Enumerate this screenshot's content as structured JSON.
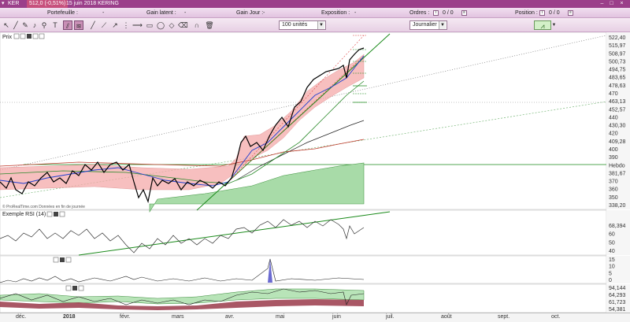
{
  "titlebar": {
    "ticker": "KER",
    "price_change": "512,0 (-0,51%)",
    "date_name": "15 juin 2018 KERING"
  },
  "summary": {
    "portefeuille_label": "Portefeuille :",
    "portefeuille_value": "-",
    "gain_latent_label": "Gain latent :",
    "gain_latent_value": "-",
    "gain_jour_label": "Gain Jour :",
    "gain_jour_value": "-",
    "exposition_label": "Exposition :",
    "exposition_value": "-",
    "ordres_label": "Ordres :",
    "ordres_value": "0 / 0",
    "position_label": "Position :",
    "position_value": "0 / 0"
  },
  "toolbar": {
    "quantity": "100 unités",
    "period": "Journalier"
  },
  "panels": {
    "price_title": "Prix",
    "rsi_title": "Exemple RSI (14)",
    "watermark": "© ProRealTime.com Données en fin de journée"
  },
  "yaxis_price": [
    {
      "label": "522,40",
      "color": "#333333"
    },
    {
      "label": "515,97",
      "color": "#c0392b"
    },
    {
      "label": "508,97",
      "color": "#333333"
    },
    {
      "label": "500,73",
      "color": "#1a8a1a"
    },
    {
      "label": "494,75",
      "color": "#333333"
    },
    {
      "label": "483,65",
      "color": "#1a8a1a"
    },
    {
      "label": "478,63",
      "color": "#1a8a1a"
    },
    {
      "label": "470",
      "color": "#333333"
    },
    {
      "label": "463,13",
      "color": "#1a8a1a"
    },
    {
      "label": "452,57",
      "color": "#333333"
    },
    {
      "label": "440",
      "color": "#333333"
    },
    {
      "label": "430,30",
      "color": "#333333"
    },
    {
      "label": "420",
      "color": "#333333"
    },
    {
      "label": "409,28",
      "color": "#c0392b"
    },
    {
      "label": "400",
      "color": "#333333"
    },
    {
      "label": "390",
      "color": "#333333"
    },
    {
      "label": "Hebdo",
      "color": "#1a8a1a"
    },
    {
      "label": "381,67",
      "color": "#333333"
    },
    {
      "label": "370",
      "color": "#333333"
    },
    {
      "label": "360",
      "color": "#333333"
    },
    {
      "label": "350",
      "color": "#333333"
    },
    {
      "label": "338,20",
      "color": "#333333"
    }
  ],
  "yaxis_rsi": [
    "68,394",
    "60",
    "50",
    "40"
  ],
  "yaxis_vol": [
    "15",
    "10",
    "5",
    "0"
  ],
  "yaxis_ichi": [
    "94,144",
    "64,293",
    "61,723",
    "54,381"
  ],
  "xaxis": [
    {
      "label": "déc.",
      "bold": false
    },
    {
      "label": "2018",
      "bold": true
    },
    {
      "label": "févr.",
      "bold": false
    },
    {
      "label": "mars",
      "bold": false
    },
    {
      "label": "avr.",
      "bold": false
    },
    {
      "label": "mai",
      "bold": false
    },
    {
      "label": "juin",
      "bold": false
    },
    {
      "label": "juil.",
      "bold": false
    },
    {
      "label": "août",
      "bold": false
    },
    {
      "label": "sept.",
      "bold": false
    },
    {
      "label": "oct.",
      "bold": false
    }
  ],
  "colors": {
    "titlebar": "#9b3f8a",
    "price_line": "#000000",
    "ma_blue": "#1f3fd0",
    "ma_red": "#c0392b",
    "trend_green": "#1a8a1a",
    "cloud_red": "#f4a9a9",
    "cloud_green": "#a8dba8"
  },
  "chart_data": {
    "type": "line",
    "title": "KERING",
    "series": [
      {
        "name": "Prix",
        "x": [
          "déc.",
          "2018",
          "févr.",
          "mars",
          "avr.",
          "mai",
          "juin"
        ],
        "values": [
          365,
          378,
          358,
          368,
          370,
          440,
          512
        ]
      },
      {
        "name": "Exemple RSI (14)",
        "x": [
          "déc.",
          "2018",
          "févr.",
          "mars",
          "avr.",
          "mai",
          "juin"
        ],
        "values": [
          55,
          62,
          42,
          55,
          58,
          66,
          64
        ]
      }
    ],
    "ylim": [
      338.2,
      525
    ],
    "grid": false,
    "legend": "none"
  }
}
